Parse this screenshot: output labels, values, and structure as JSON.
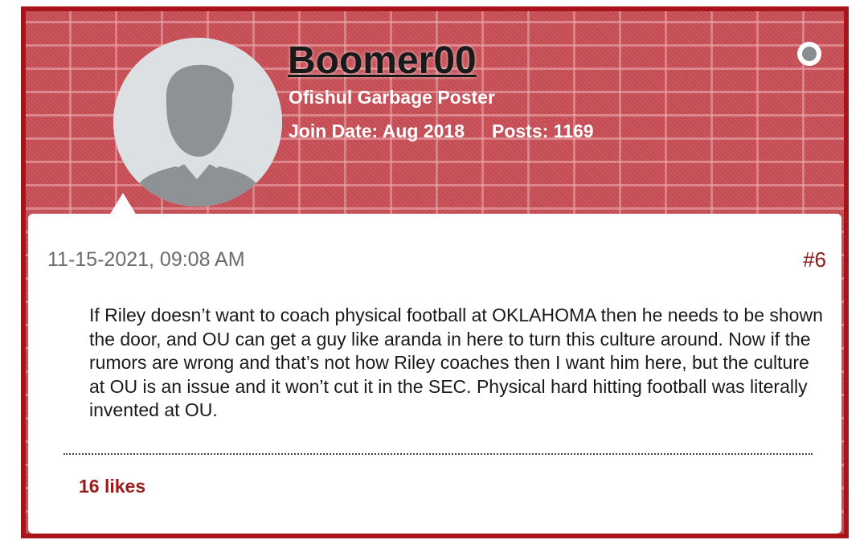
{
  "user": {
    "username": "Boomer00",
    "title": "Ofishul Garbage Poster",
    "join_date": "Join Date: Aug 2018",
    "posts": "Posts: 1169",
    "status": "offline"
  },
  "post": {
    "date": "11-15-2021, 09:08 AM",
    "number": "#6",
    "body": "If Riley doesn’t want to coach physical football at OKLAHOMA then he needs to be shown the door, and OU can get a guy like aranda in here to turn this culture around. Now if the rumors are wrong and that’s not how Riley coaches then I want him here, but the culture at OU is an issue and it won’t cut it in the SEC. Physical hard hitting football was literally invented at OU.",
    "likes": "16 likes"
  },
  "colors": {
    "border": "#a8141a",
    "banner": "#c94e55",
    "accent_text": "#9b1b1b",
    "status_dot": "#8a8d90"
  },
  "icons": {
    "avatar": "default-user-silhouette-icon",
    "status": "online-status-icon"
  }
}
